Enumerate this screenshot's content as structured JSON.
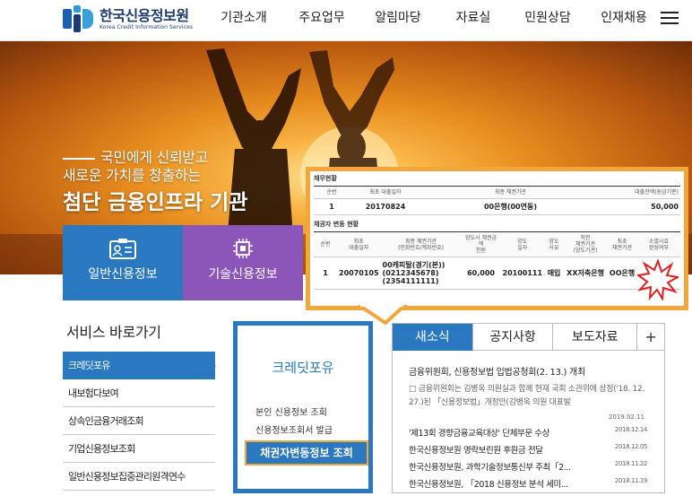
{
  "header": {
    "logo_name": "한국신용정보원",
    "logo_sub": "Korea Credit Information Services",
    "nav": [
      "기관소개",
      "주요업무",
      "알림마당",
      "자료실",
      "민원상담",
      "인재채용"
    ]
  },
  "hero": {
    "line1": "국민에게 신뢰받고",
    "line2": "새로운 가치를 창출하는",
    "title": "첨단 금융인프라 기관"
  },
  "tiles": [
    {
      "label": "일반신용정보",
      "color": "#2a78bf"
    },
    {
      "label": "기술신용정보",
      "color": "#8b56b8"
    }
  ],
  "popup": {
    "section1_title": "채무현황",
    "t1_headers": [
      "순번",
      "최초 대출일자",
      "최종 채권기관",
      "대출잔액(원금기준)"
    ],
    "t1_row": [
      "1",
      "20170824",
      "00은행(00연동)",
      "50,000"
    ],
    "section2_title": "채권자 변동 현황",
    "t2_headers": [
      "순번",
      "최초\n대출일자",
      "최종 채권기관\n(전화번호/계좌번호)",
      "양도시 채권금액\n천원",
      "양도\n일자",
      "양도\n사유",
      "직전\n채권기관\n(양도기관)",
      "최초\n채권기관",
      "소멸시효\n완성여부"
    ],
    "t2_row": [
      "1",
      "20070105",
      "00캐피탈(경기(본))\n(0212345678)\n(2354111111)",
      "60,000",
      "20100111",
      "매입",
      "XX저축은행",
      "OO은행",
      "o"
    ]
  },
  "services": {
    "title": "서비스 바로가기",
    "items": [
      "크레딧포유",
      "내보험다보여",
      "상속인금융거래조회",
      "기업신용정보조회",
      "일반신용정보집중관리원격연수"
    ]
  },
  "creditforyou": {
    "title": "크레딧포유",
    "links": [
      "본인 신용정보 조회",
      "신용정보조회서 발급"
    ],
    "button": "채권자변동정보 조회"
  },
  "news": {
    "tabs": [
      "새소식",
      "공지사항",
      "보도자료"
    ],
    "plus": "+",
    "headline": "금융위원회, 신용정보법 입법공청회(2. 13.) 개최",
    "summary": "□ 금융위원회는 김병욱 의원실과 함께 현재 국회 소관위에 상정('18. 12. 27.)된 「신용정보법」개정안(김병욱 의원 대표발",
    "headline_date": "2019.02.11",
    "items": [
      {
        "title": "'제13회 경향금융교육대상' 단체부문 수상",
        "date": "2018.12.14"
      },
      {
        "title": "한국신용정보원 영락보린원 후원금 전달",
        "date": "2018.12.05"
      },
      {
        "title": "한국신용정보원, 과학기술정보통신부 주최「2...",
        "date": "2018.11.22"
      },
      {
        "title": "한국신용정보원, 「2018 신용정보 분석 세미...",
        "date": "2018.11.19"
      }
    ]
  }
}
